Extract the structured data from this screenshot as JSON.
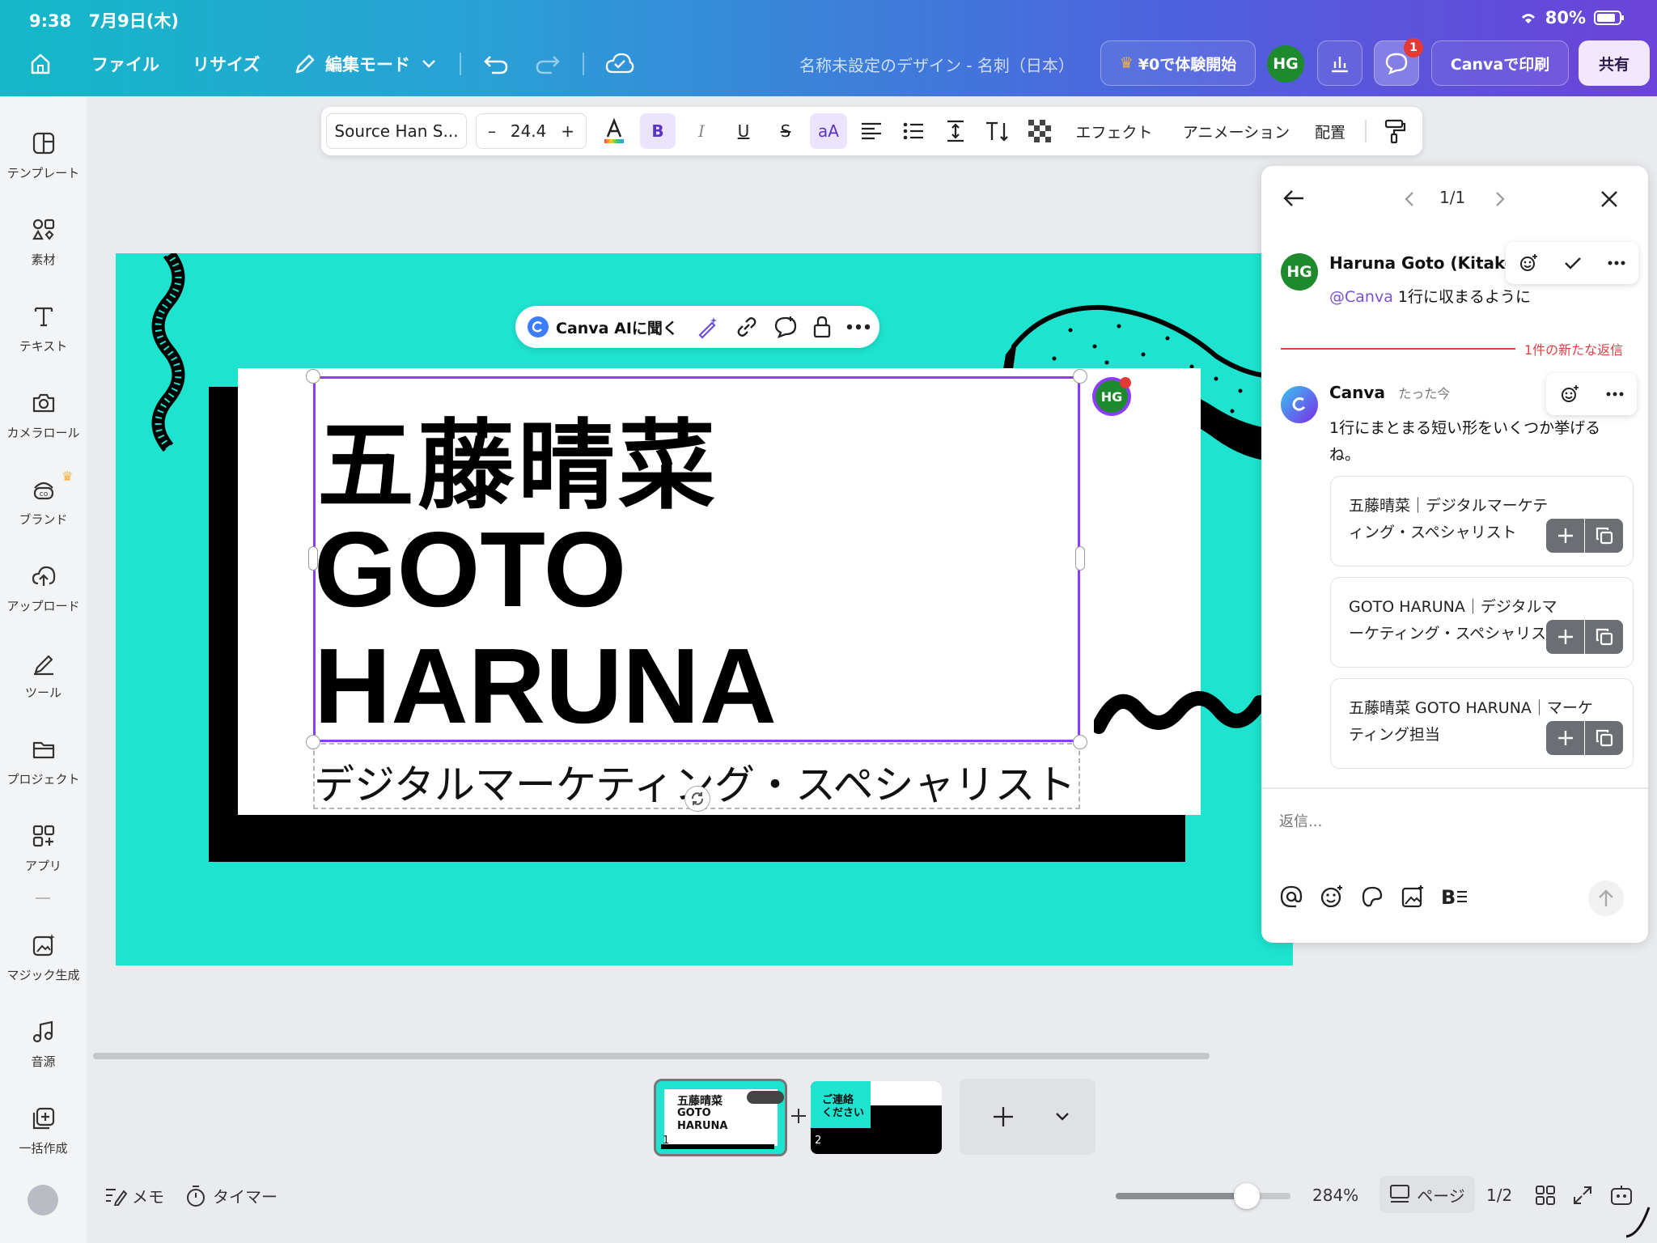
{
  "status": {
    "time": "9:38",
    "date": "7月9日(木)",
    "battery": "80%"
  },
  "topbar": {
    "file": "ファイル",
    "resize": "リサイズ",
    "edit_mode": "編集モード",
    "design_title": "名称未設定のデザイン - 名刺（日本）",
    "trial": "¥0で体験開始",
    "avatar": "HG",
    "comment_badge": "1",
    "print": "Canvaで印刷",
    "share": "共有"
  },
  "sidebar": {
    "items": [
      {
        "label": "テンプレート",
        "icon": "template-icon"
      },
      {
        "label": "素材",
        "icon": "elements-icon"
      },
      {
        "label": "テキスト",
        "icon": "text-icon"
      },
      {
        "label": "カメラロール",
        "icon": "camera-icon"
      },
      {
        "label": "ブランド",
        "icon": "brand-icon"
      },
      {
        "label": "アップロード",
        "icon": "upload-icon"
      },
      {
        "label": "ツール",
        "icon": "tools-icon"
      },
      {
        "label": "プロジェクト",
        "icon": "folder-icon"
      },
      {
        "label": "アプリ",
        "icon": "apps-icon"
      },
      {
        "label": "マジック生成",
        "icon": "magic-icon"
      },
      {
        "label": "音源",
        "icon": "music-icon"
      },
      {
        "label": "一括作成",
        "icon": "bulk-icon"
      }
    ]
  },
  "format_toolbar": {
    "font": "Source Han S...",
    "size": "24.4",
    "minus": "–",
    "plus": "+",
    "bold": "B",
    "italic": "I",
    "underline": "U",
    "strike": "S",
    "case": "aA",
    "effects": "エフェクト",
    "animation": "アニメーション",
    "position": "配置"
  },
  "ai_bar": {
    "label": "Canva AIに聞く"
  },
  "design": {
    "name_jp": "五藤晴菜",
    "name_en_1": "GOTO",
    "name_en_2": "HARUNA",
    "role": "デジタルマーケティング・スペシャリスト",
    "comment_pin": "HG",
    "colors": {
      "background": "#1ee3cf",
      "card": "#ffffff",
      "ink": "#000000",
      "selection": "#8b3dff"
    }
  },
  "comments": {
    "pager": "1/1",
    "first": {
      "author": "Haruna Goto (Kitakoji",
      "avatar": "HG",
      "mention": "@Canva",
      "text": "1行に収まるように"
    },
    "new_replies": "1件の新たな返信",
    "reply": {
      "author": "Canva",
      "time": "たった今",
      "text": "1行にまとまる短い形をいくつか挙げるね。"
    },
    "suggestions": [
      "五藤晴菜｜デジタルマーケティング・スペシャリスト",
      "GOTO HARUNA｜デジタルマーケティング・スペシャリスト",
      "五藤晴菜 GOTO HARUNA｜マーケティング担当"
    ],
    "reply_placeholder": "返信..."
  },
  "pages": {
    "thumb1": {
      "num": "1",
      "line1": "五藤晴菜",
      "line2": "GOTO",
      "line3": "HARUNA"
    },
    "thumb2": {
      "num": "2",
      "heading1": "ご連絡",
      "heading2": "ください"
    }
  },
  "bottom": {
    "memo": "メモ",
    "timer": "タイマー",
    "zoom": "284%",
    "zoom_level": 0.75,
    "page_view": "ページ",
    "page_count": "1/2"
  }
}
